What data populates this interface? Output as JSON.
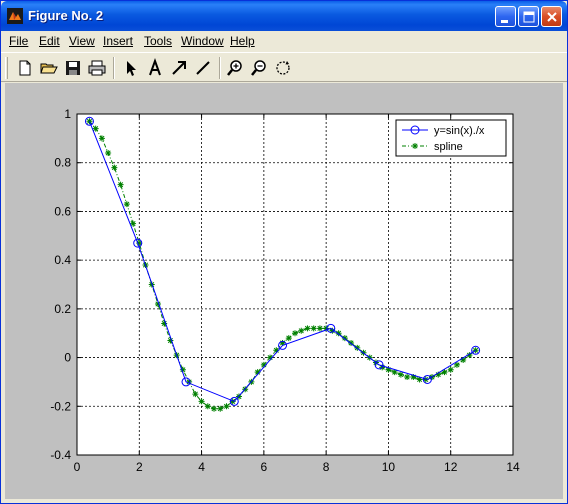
{
  "window": {
    "title": "Figure No. 2",
    "title_color": "#ffffff",
    "titlebar_color": "#0a5ae0"
  },
  "menu": {
    "items": [
      {
        "label": "File",
        "name": "menu-file"
      },
      {
        "label": "Edit",
        "name": "menu-edit"
      },
      {
        "label": "View",
        "name": "menu-view"
      },
      {
        "label": "Insert",
        "name": "menu-insert"
      },
      {
        "label": "Tools",
        "name": "menu-tools"
      },
      {
        "label": "Window",
        "name": "menu-window"
      },
      {
        "label": "Help",
        "name": "menu-help"
      }
    ]
  },
  "toolbar": {
    "icons": [
      "new-file-icon",
      "open-folder-icon",
      "save-icon",
      "print-icon",
      "select-arrow-icon",
      "insert-text-icon",
      "insert-arrow-icon",
      "insert-line-icon",
      "zoom-in-icon",
      "zoom-out-icon",
      "rotate-3d-icon"
    ]
  },
  "chart_data": {
    "type": "line",
    "title": "",
    "xlabel": "",
    "ylabel": "",
    "xlim": [
      0,
      14
    ],
    "ylim": [
      -0.4,
      1
    ],
    "xticks": [
      0,
      2,
      4,
      6,
      8,
      10,
      12,
      14
    ],
    "yticks": [
      -0.4,
      -0.2,
      0,
      0.2,
      0.4,
      0.6,
      0.8,
      1
    ],
    "grid": true,
    "grid_style": "dashed",
    "legend_position": "top-right",
    "series": [
      {
        "name": "y=sin(x)./x",
        "style": "line with circle markers",
        "color": "#0000ff",
        "x": [
          0.4,
          1.95,
          3.5,
          5.05,
          6.6,
          8.15,
          9.7,
          11.25,
          12.8
        ],
        "y": [
          0.97,
          0.47,
          -0.1,
          -0.18,
          0.05,
          0.12,
          -0.03,
          -0.09,
          0.03
        ]
      },
      {
        "name": "spline",
        "style": "dash-dot line with star markers",
        "color": "#008000",
        "x": [
          0.4,
          0.6,
          0.8,
          1.0,
          1.2,
          1.4,
          1.6,
          1.8,
          2.0,
          2.2,
          2.4,
          2.6,
          2.8,
          3.0,
          3.2,
          3.4,
          3.6,
          3.8,
          4.0,
          4.2,
          4.4,
          4.6,
          4.8,
          5.0,
          5.2,
          5.4,
          5.6,
          5.8,
          6.0,
          6.2,
          6.4,
          6.6,
          6.8,
          7.0,
          7.2,
          7.4,
          7.6,
          7.8,
          8.0,
          8.2,
          8.4,
          8.6,
          8.8,
          9.0,
          9.2,
          9.4,
          9.6,
          9.8,
          10.0,
          10.2,
          10.4,
          10.6,
          10.8,
          11.0,
          11.2,
          11.4,
          11.6,
          11.8,
          12.0,
          12.2,
          12.4,
          12.6,
          12.8
        ],
        "y": [
          0.97,
          0.94,
          0.9,
          0.84,
          0.78,
          0.71,
          0.63,
          0.55,
          0.47,
          0.38,
          0.3,
          0.22,
          0.14,
          0.07,
          0.01,
          -0.05,
          -0.1,
          -0.15,
          -0.18,
          -0.2,
          -0.21,
          -0.21,
          -0.2,
          -0.18,
          -0.16,
          -0.13,
          -0.1,
          -0.06,
          -0.03,
          0.0,
          0.03,
          0.06,
          0.08,
          0.1,
          0.11,
          0.12,
          0.12,
          0.12,
          0.12,
          0.11,
          0.1,
          0.08,
          0.06,
          0.04,
          0.02,
          0.0,
          -0.02,
          -0.04,
          -0.05,
          -0.06,
          -0.07,
          -0.08,
          -0.08,
          -0.09,
          -0.09,
          -0.08,
          -0.07,
          -0.06,
          -0.05,
          -0.03,
          -0.01,
          0.01,
          0.03
        ]
      }
    ]
  }
}
